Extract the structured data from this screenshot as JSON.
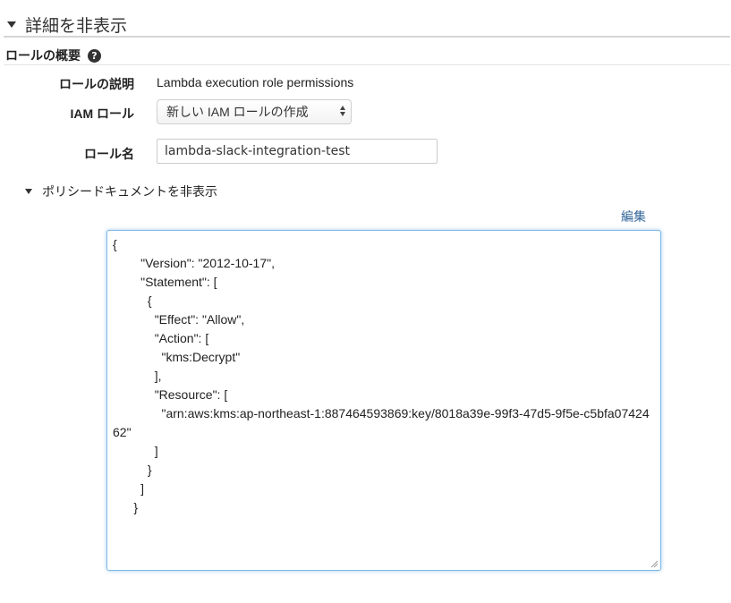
{
  "section": {
    "title": "詳細を非表示"
  },
  "role_overview": {
    "title": "ロールの概要",
    "help_icon": "question-circle-icon"
  },
  "fields": {
    "description_label": "ロールの説明",
    "description_value": "Lambda execution role permissions",
    "iam_role_label": "IAM ロール",
    "iam_role_selected": "新しい IAM ロールの作成",
    "role_name_label": "ロール名",
    "role_name_value": "lambda-slack-integration-test"
  },
  "policy": {
    "toggle_label": "ポリシードキュメントを非表示",
    "edit_label": "編集",
    "document": "{\n        \"Version\": \"2012-10-17\",\n        \"Statement\": [\n          {\n            \"Effect\": \"Allow\",\n            \"Action\": [\n              \"kms:Decrypt\"\n            ],\n            \"Resource\": [\n              \"arn:aws:kms:ap-northeast-1:887464593869:key/8018a39e-99f3-47d5-9f5e-c5bfa0742462\"\n            ]\n          }\n        ]\n      }"
  },
  "colors": {
    "link": "#336699",
    "focus_border": "#7fb8e6"
  }
}
